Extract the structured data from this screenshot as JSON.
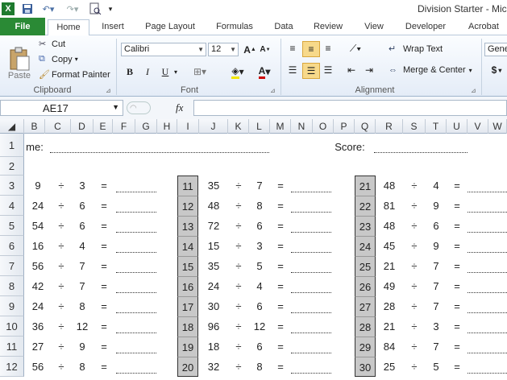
{
  "window": {
    "title": "Division Starter - Mic",
    "quick_access": [
      "excel-logo-icon",
      "save-icon",
      "undo-icon",
      "redo-icon",
      "print-preview-icon",
      "customize-icon"
    ]
  },
  "tabs": [
    "File",
    "Home",
    "Insert",
    "Page Layout",
    "Formulas",
    "Data",
    "Review",
    "View",
    "Developer",
    "Acrobat"
  ],
  "ribbon": {
    "clipboard": {
      "paste": "Paste",
      "cut": "Cut",
      "copy": "Copy",
      "format_painter": "Format Painter",
      "label": "Clipboard"
    },
    "font": {
      "name": "Calibri",
      "size": "12",
      "bold": "B",
      "italic": "I",
      "underline": "U",
      "label": "Font"
    },
    "alignment": {
      "wrap_text": "Wrap Text",
      "merge_center": "Merge & Center",
      "label": "Alignment"
    },
    "number": {
      "format": "Gene",
      "currency": "$"
    }
  },
  "formula_bar": {
    "name_box": "AE17",
    "fx": "fx",
    "value": ""
  },
  "columns": [
    "B",
    "C",
    "D",
    "E",
    "F",
    "G",
    "H",
    "I",
    "J",
    "K",
    "L",
    "M",
    "N",
    "O",
    "P",
    "Q",
    "R",
    "S",
    "T",
    "U",
    "V",
    "W"
  ],
  "rows": [
    "1",
    "2",
    "3",
    "4",
    "5",
    "6",
    "7",
    "8",
    "9",
    "10",
    "11",
    "12"
  ],
  "sheet": {
    "name_label": "me:",
    "score_label": "Score:",
    "operator": "÷",
    "equals": "=",
    "blocks": [
      {
        "problems": [
          {
            "n": "",
            "a": "9",
            "b": "3"
          },
          {
            "n": "",
            "a": "24",
            "b": "6"
          },
          {
            "n": "",
            "a": "54",
            "b": "6"
          },
          {
            "n": "",
            "a": "16",
            "b": "4"
          },
          {
            "n": "",
            "a": "56",
            "b": "7"
          },
          {
            "n": "",
            "a": "42",
            "b": "7"
          },
          {
            "n": "",
            "a": "24",
            "b": "8"
          },
          {
            "n": "",
            "a": "36",
            "b": "12"
          },
          {
            "n": "",
            "a": "27",
            "b": "9"
          },
          {
            "n": "",
            "a": "56",
            "b": "8"
          }
        ]
      },
      {
        "problems": [
          {
            "n": "11",
            "a": "35",
            "b": "7"
          },
          {
            "n": "12",
            "a": "48",
            "b": "8"
          },
          {
            "n": "13",
            "a": "72",
            "b": "6"
          },
          {
            "n": "14",
            "a": "15",
            "b": "3"
          },
          {
            "n": "15",
            "a": "35",
            "b": "5"
          },
          {
            "n": "16",
            "a": "24",
            "b": "4"
          },
          {
            "n": "17",
            "a": "30",
            "b": "6"
          },
          {
            "n": "18",
            "a": "96",
            "b": "12"
          },
          {
            "n": "19",
            "a": "18",
            "b": "6"
          },
          {
            "n": "20",
            "a": "32",
            "b": "8"
          }
        ]
      },
      {
        "problems": [
          {
            "n": "21",
            "a": "48",
            "b": "4"
          },
          {
            "n": "22",
            "a": "81",
            "b": "9"
          },
          {
            "n": "23",
            "a": "48",
            "b": "6"
          },
          {
            "n": "24",
            "a": "45",
            "b": "9"
          },
          {
            "n": "25",
            "a": "21",
            "b": "7"
          },
          {
            "n": "26",
            "a": "49",
            "b": "7"
          },
          {
            "n": "27",
            "a": "28",
            "b": "7"
          },
          {
            "n": "28",
            "a": "21",
            "b": "3"
          },
          {
            "n": "29",
            "a": "84",
            "b": "7"
          },
          {
            "n": "30",
            "a": "25",
            "b": "5"
          }
        ]
      }
    ]
  }
}
